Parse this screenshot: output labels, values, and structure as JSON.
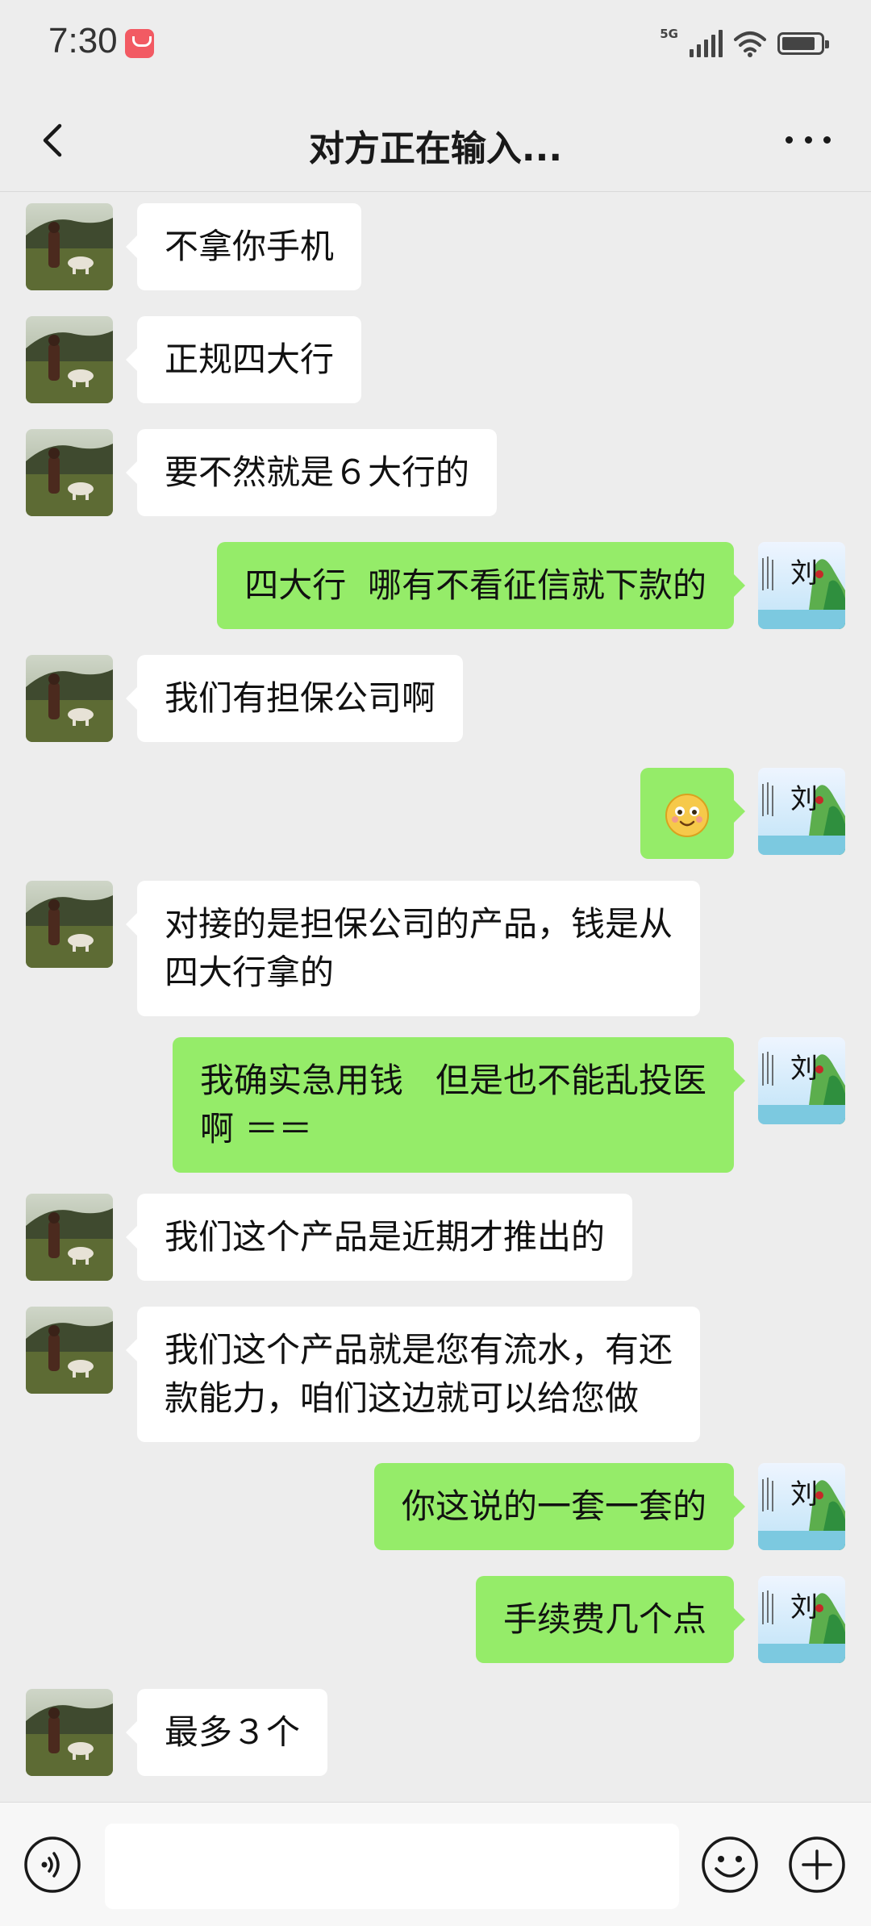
{
  "status_bar": {
    "time": "7:30",
    "network": "5G"
  },
  "header": {
    "title": "对方正在输入..."
  },
  "messages": [
    {
      "sender": "them",
      "text": "不拿你手机"
    },
    {
      "sender": "them",
      "text": "正规四大行"
    },
    {
      "sender": "them",
      "text": "要不然就是６大行的"
    },
    {
      "sender": "me",
      "text": "四大行  哪有不看征信就下款的"
    },
    {
      "sender": "them",
      "text": "我们有担保公司啊"
    },
    {
      "sender": "me",
      "icon": "smiling-face-emoji"
    },
    {
      "sender": "them",
      "text": "对接的是担保公司的产品，钱是从\n四大行拿的"
    },
    {
      "sender": "me",
      "text": "我确实急用钱   但是也不能乱投医\n啊 ＝＝"
    },
    {
      "sender": "them",
      "text": "我们这个产品是近期才推出的"
    },
    {
      "sender": "them",
      "text": "我们这个产品就是您有流水，有还\n款能力，咱们这边就可以给您做"
    },
    {
      "sender": "me",
      "text": "你这说的一套一套的"
    },
    {
      "sender": "me",
      "text": "手续费几个点"
    },
    {
      "sender": "them",
      "text": "最多３个"
    }
  ],
  "composer": {
    "placeholder": ""
  },
  "colors": {
    "background": "#ededed",
    "own_bubble": "#95ec69",
    "other_bubble": "#ffffff"
  }
}
